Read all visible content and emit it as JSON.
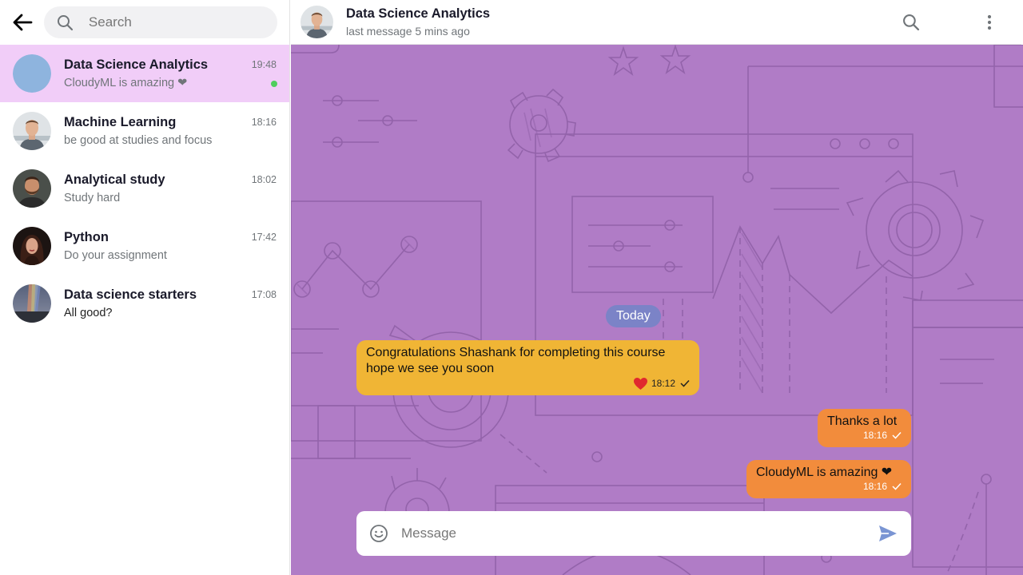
{
  "sidebar": {
    "search_placeholder": "Search",
    "chats": [
      {
        "name": "Data Science Analytics",
        "preview": "CloudyML is amazing ❤",
        "time": "19:48",
        "active": true,
        "online": true,
        "avatar": "blue-circle"
      },
      {
        "name": "Machine Learning",
        "preview": "be good at studies and focus",
        "time": "18:16",
        "avatar": "photo-man-1"
      },
      {
        "name": "Analytical study",
        "preview": "Study hard",
        "time": "18:02",
        "avatar": "photo-man-2"
      },
      {
        "name": "Python",
        "preview": "Do your assignment",
        "time": "17:42",
        "avatar": "photo-woman"
      },
      {
        "name": "Data science starters",
        "preview": "All good?",
        "time": "17:08",
        "avatar": "photo-landscape"
      }
    ]
  },
  "header": {
    "title": "Data Science Analytics",
    "subtitle": "last message 5 mins ago"
  },
  "messages": {
    "date_label": "Today",
    "items": [
      {
        "direction": "in",
        "text": "Congratulations  Shashank for completing this course hope we see you soon",
        "time": "18:12",
        "reaction": "red-heart"
      },
      {
        "direction": "out",
        "text": "Thanks a lot",
        "time": "18:16"
      },
      {
        "direction": "out",
        "text": "CloudyML is amazing ❤",
        "time": "18:16"
      }
    ]
  },
  "composer": {
    "placeholder": "Message"
  },
  "colors": {
    "active_chat": "#f1cdf8",
    "chat_background": "#b07cc6",
    "incoming_bubble": "#f0b535",
    "outgoing_bubble": "#f28c3c",
    "date_pill": "#7b83c7",
    "online": "#4fce5d",
    "send_icon": "#7a95d3"
  }
}
